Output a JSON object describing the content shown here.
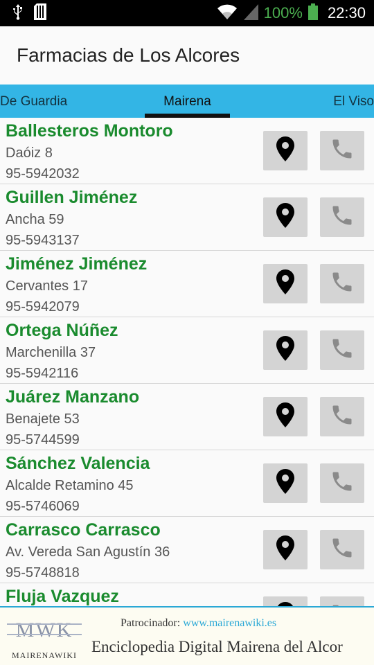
{
  "status_bar": {
    "battery": "100%",
    "time": "22:30",
    "battery_color": "#4caf50"
  },
  "app": {
    "title": "Farmacias de Los Alcores"
  },
  "tabs": [
    {
      "label": "De Guardia",
      "selected": false
    },
    {
      "label": "Mairena",
      "selected": true
    },
    {
      "label": "El Viso",
      "selected": false
    }
  ],
  "pharmacies": [
    {
      "name": "Ballesteros Montoro",
      "address": "Daóiz 8",
      "phone": "95-5942032"
    },
    {
      "name": "Guillen Jiménez",
      "address": "Ancha 59",
      "phone": "95-5943137"
    },
    {
      "name": "Jiménez Jiménez",
      "address": "Cervantes 17",
      "phone": "95-5942079"
    },
    {
      "name": "Ortega Núñez",
      "address": "Marchenilla 37",
      "phone": "95-5942116"
    },
    {
      "name": "Juárez Manzano",
      "address": "Benajete 53",
      "phone": "95-5744599"
    },
    {
      "name": "Sánchez Valencia",
      "address": "Alcalde Retamino 45",
      "phone": "95-5746069"
    },
    {
      "name": "Carrasco Carrasco",
      "address": "Av. Vereda San Agustín 36",
      "phone": "95-5748818"
    },
    {
      "name": "Fluja Vazquez",
      "address": "",
      "phone": ""
    }
  ],
  "icons": {
    "map": "map-marker-icon",
    "call": "phone-icon"
  },
  "banner": {
    "logo_mark": "MWK",
    "logo_text": "MAIRENAWIKI",
    "sponsor_label": "Patrocinador:",
    "sponsor_url": "www.mairenawiki.es",
    "tagline": "Enciclopedia Digital Mairena del Alcor"
  },
  "colors": {
    "tab_bar": "#33b5e5",
    "name_green": "#1a8b2e",
    "banner_accent": "#2aa8d6"
  }
}
